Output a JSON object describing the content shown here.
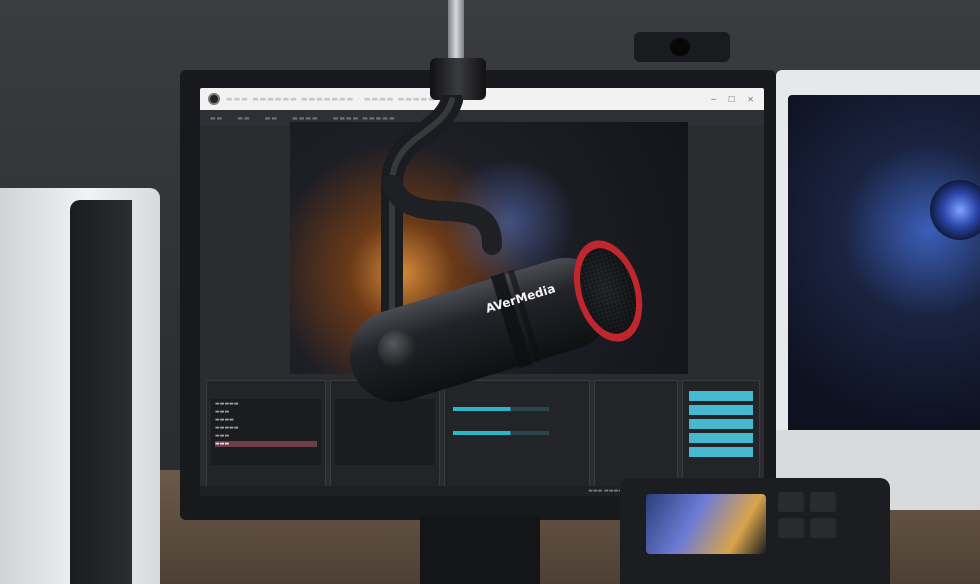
{
  "scene": {
    "colors": {
      "wall": "#3a3c40",
      "desk": "#6b5a4a",
      "accent_red": "#c0262e",
      "obs_button": "#45b9cf"
    },
    "mic": {
      "brand": "AVerMedia"
    },
    "icons": [
      "app-icon",
      "microphone-icon",
      "webcam-icon",
      "fan-icon"
    ]
  }
}
